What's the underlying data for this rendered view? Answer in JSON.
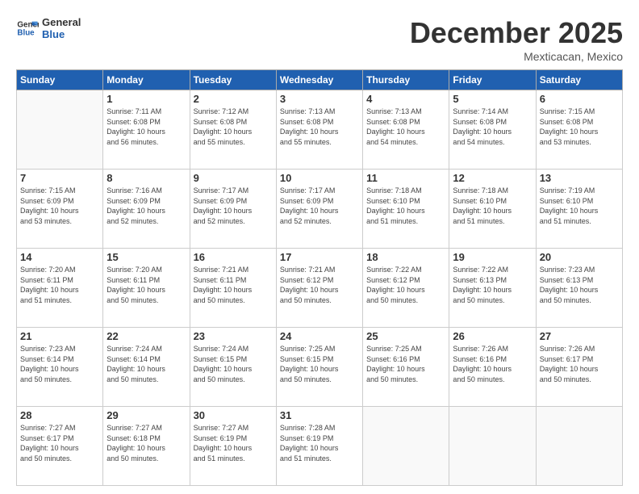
{
  "logo": {
    "line1": "General",
    "line2": "Blue"
  },
  "title": "December 2025",
  "subtitle": "Mexticacan, Mexico",
  "days_header": [
    "Sunday",
    "Monday",
    "Tuesday",
    "Wednesday",
    "Thursday",
    "Friday",
    "Saturday"
  ],
  "weeks": [
    [
      {
        "day": "",
        "info": ""
      },
      {
        "day": "1",
        "info": "Sunrise: 7:11 AM\nSunset: 6:08 PM\nDaylight: 10 hours\nand 56 minutes."
      },
      {
        "day": "2",
        "info": "Sunrise: 7:12 AM\nSunset: 6:08 PM\nDaylight: 10 hours\nand 55 minutes."
      },
      {
        "day": "3",
        "info": "Sunrise: 7:13 AM\nSunset: 6:08 PM\nDaylight: 10 hours\nand 55 minutes."
      },
      {
        "day": "4",
        "info": "Sunrise: 7:13 AM\nSunset: 6:08 PM\nDaylight: 10 hours\nand 54 minutes."
      },
      {
        "day": "5",
        "info": "Sunrise: 7:14 AM\nSunset: 6:08 PM\nDaylight: 10 hours\nand 54 minutes."
      },
      {
        "day": "6",
        "info": "Sunrise: 7:15 AM\nSunset: 6:08 PM\nDaylight: 10 hours\nand 53 minutes."
      }
    ],
    [
      {
        "day": "7",
        "info": "Sunrise: 7:15 AM\nSunset: 6:09 PM\nDaylight: 10 hours\nand 53 minutes."
      },
      {
        "day": "8",
        "info": "Sunrise: 7:16 AM\nSunset: 6:09 PM\nDaylight: 10 hours\nand 52 minutes."
      },
      {
        "day": "9",
        "info": "Sunrise: 7:17 AM\nSunset: 6:09 PM\nDaylight: 10 hours\nand 52 minutes."
      },
      {
        "day": "10",
        "info": "Sunrise: 7:17 AM\nSunset: 6:09 PM\nDaylight: 10 hours\nand 52 minutes."
      },
      {
        "day": "11",
        "info": "Sunrise: 7:18 AM\nSunset: 6:10 PM\nDaylight: 10 hours\nand 51 minutes."
      },
      {
        "day": "12",
        "info": "Sunrise: 7:18 AM\nSunset: 6:10 PM\nDaylight: 10 hours\nand 51 minutes."
      },
      {
        "day": "13",
        "info": "Sunrise: 7:19 AM\nSunset: 6:10 PM\nDaylight: 10 hours\nand 51 minutes."
      }
    ],
    [
      {
        "day": "14",
        "info": "Sunrise: 7:20 AM\nSunset: 6:11 PM\nDaylight: 10 hours\nand 51 minutes."
      },
      {
        "day": "15",
        "info": "Sunrise: 7:20 AM\nSunset: 6:11 PM\nDaylight: 10 hours\nand 50 minutes."
      },
      {
        "day": "16",
        "info": "Sunrise: 7:21 AM\nSunset: 6:11 PM\nDaylight: 10 hours\nand 50 minutes."
      },
      {
        "day": "17",
        "info": "Sunrise: 7:21 AM\nSunset: 6:12 PM\nDaylight: 10 hours\nand 50 minutes."
      },
      {
        "day": "18",
        "info": "Sunrise: 7:22 AM\nSunset: 6:12 PM\nDaylight: 10 hours\nand 50 minutes."
      },
      {
        "day": "19",
        "info": "Sunrise: 7:22 AM\nSunset: 6:13 PM\nDaylight: 10 hours\nand 50 minutes."
      },
      {
        "day": "20",
        "info": "Sunrise: 7:23 AM\nSunset: 6:13 PM\nDaylight: 10 hours\nand 50 minutes."
      }
    ],
    [
      {
        "day": "21",
        "info": "Sunrise: 7:23 AM\nSunset: 6:14 PM\nDaylight: 10 hours\nand 50 minutes."
      },
      {
        "day": "22",
        "info": "Sunrise: 7:24 AM\nSunset: 6:14 PM\nDaylight: 10 hours\nand 50 minutes."
      },
      {
        "day": "23",
        "info": "Sunrise: 7:24 AM\nSunset: 6:15 PM\nDaylight: 10 hours\nand 50 minutes."
      },
      {
        "day": "24",
        "info": "Sunrise: 7:25 AM\nSunset: 6:15 PM\nDaylight: 10 hours\nand 50 minutes."
      },
      {
        "day": "25",
        "info": "Sunrise: 7:25 AM\nSunset: 6:16 PM\nDaylight: 10 hours\nand 50 minutes."
      },
      {
        "day": "26",
        "info": "Sunrise: 7:26 AM\nSunset: 6:16 PM\nDaylight: 10 hours\nand 50 minutes."
      },
      {
        "day": "27",
        "info": "Sunrise: 7:26 AM\nSunset: 6:17 PM\nDaylight: 10 hours\nand 50 minutes."
      }
    ],
    [
      {
        "day": "28",
        "info": "Sunrise: 7:27 AM\nSunset: 6:17 PM\nDaylight: 10 hours\nand 50 minutes."
      },
      {
        "day": "29",
        "info": "Sunrise: 7:27 AM\nSunset: 6:18 PM\nDaylight: 10 hours\nand 50 minutes."
      },
      {
        "day": "30",
        "info": "Sunrise: 7:27 AM\nSunset: 6:19 PM\nDaylight: 10 hours\nand 51 minutes."
      },
      {
        "day": "31",
        "info": "Sunrise: 7:28 AM\nSunset: 6:19 PM\nDaylight: 10 hours\nand 51 minutes."
      },
      {
        "day": "",
        "info": ""
      },
      {
        "day": "",
        "info": ""
      },
      {
        "day": "",
        "info": ""
      }
    ]
  ]
}
